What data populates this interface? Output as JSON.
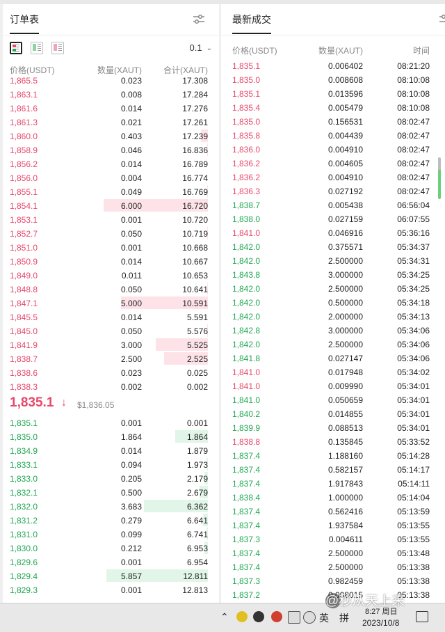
{
  "order_book": {
    "tab_title": "订单表",
    "precision": "0.1",
    "columns": {
      "price": "价格(USDT)",
      "amount": "数量(XAUT)",
      "total": "合计(XAUT)"
    },
    "asks": [
      {
        "price": "1,865.5",
        "amount": "0.023",
        "total": "17.308",
        "depth": 0
      },
      {
        "price": "1,863.1",
        "amount": "0.008",
        "total": "17.284",
        "depth": 0
      },
      {
        "price": "1,861.6",
        "amount": "0.014",
        "total": "17.276",
        "depth": 0
      },
      {
        "price": "1,861.3",
        "amount": "0.021",
        "total": "17.261",
        "depth": 0
      },
      {
        "price": "1,860.0",
        "amount": "0.403",
        "total": "17.239",
        "depth": 0.067
      },
      {
        "price": "1,858.9",
        "amount": "0.046",
        "total": "16.836",
        "depth": 0.008
      },
      {
        "price": "1,856.2",
        "amount": "0.014",
        "total": "16.789",
        "depth": 0
      },
      {
        "price": "1,856.0",
        "amount": "0.004",
        "total": "16.774",
        "depth": 0
      },
      {
        "price": "1,855.1",
        "amount": "0.049",
        "total": "16.769",
        "depth": 0.008
      },
      {
        "price": "1,854.1",
        "amount": "6.000",
        "total": "16.720",
        "depth": 1.0
      },
      {
        "price": "1,853.1",
        "amount": "0.001",
        "total": "10.720",
        "depth": 0
      },
      {
        "price": "1,852.7",
        "amount": "0.050",
        "total": "10.719",
        "depth": 0.008
      },
      {
        "price": "1,851.0",
        "amount": "0.001",
        "total": "10.668",
        "depth": 0
      },
      {
        "price": "1,850.9",
        "amount": "0.014",
        "total": "10.667",
        "depth": 0
      },
      {
        "price": "1,849.0",
        "amount": "0.011",
        "total": "10.653",
        "depth": 0
      },
      {
        "price": "1,848.8",
        "amount": "0.050",
        "total": "10.641",
        "depth": 0.008
      },
      {
        "price": "1,847.1",
        "amount": "5.000",
        "total": "10.591",
        "depth": 0.833
      },
      {
        "price": "1,845.5",
        "amount": "0.014",
        "total": "5.591",
        "depth": 0
      },
      {
        "price": "1,845.0",
        "amount": "0.050",
        "total": "5.576",
        "depth": 0.008
      },
      {
        "price": "1,841.9",
        "amount": "3.000",
        "total": "5.525",
        "depth": 0.5
      },
      {
        "price": "1,838.7",
        "amount": "2.500",
        "total": "2.525",
        "depth": 0.417
      },
      {
        "price": "1,838.6",
        "amount": "0.023",
        "total": "0.025",
        "depth": 0
      },
      {
        "price": "1,838.3",
        "amount": "0.002",
        "total": "0.002",
        "depth": 0
      }
    ],
    "last_price": "1,835.1",
    "last_arrow": "↓",
    "index_price": "$1,836.05",
    "bids": [
      {
        "price": "1,835.1",
        "amount": "0.001",
        "total": "0.001",
        "depth": 0
      },
      {
        "price": "1,835.0",
        "amount": "1.864",
        "total": "1.864",
        "depth": 0.31
      },
      {
        "price": "1,834.9",
        "amount": "0.014",
        "total": "1.879",
        "depth": 0
      },
      {
        "price": "1,833.1",
        "amount": "0.094",
        "total": "1.973",
        "depth": 0.016
      },
      {
        "price": "1,833.0",
        "amount": "0.205",
        "total": "2.179",
        "depth": 0.034
      },
      {
        "price": "1,832.1",
        "amount": "0.500",
        "total": "2.679",
        "depth": 0.083
      },
      {
        "price": "1,832.0",
        "amount": "3.683",
        "total": "6.362",
        "depth": 0.614
      },
      {
        "price": "1,831.2",
        "amount": "0.279",
        "total": "6.641",
        "depth": 0.047
      },
      {
        "price": "1,831.0",
        "amount": "0.099",
        "total": "6.741",
        "depth": 0.016
      },
      {
        "price": "1,830.0",
        "amount": "0.212",
        "total": "6.953",
        "depth": 0.035
      },
      {
        "price": "1,829.6",
        "amount": "0.001",
        "total": "6.954",
        "depth": 0
      },
      {
        "price": "1,829.4",
        "amount": "5.857",
        "total": "12.811",
        "depth": 0.976
      },
      {
        "price": "1,829.3",
        "amount": "0.001",
        "total": "12.813",
        "depth": 0
      }
    ]
  },
  "trades": {
    "tab_title": "最新成交",
    "columns": {
      "price": "价格(USDT)",
      "amount": "数量(XAUT)",
      "time": "时间"
    },
    "rows": [
      {
        "price": "1,835.1",
        "amount": "0.006402",
        "time": "08:21:20",
        "side": "sell"
      },
      {
        "price": "1,835.0",
        "amount": "0.008608",
        "time": "08:10:08",
        "side": "sell"
      },
      {
        "price": "1,835.1",
        "amount": "0.013596",
        "time": "08:10:08",
        "side": "sell"
      },
      {
        "price": "1,835.4",
        "amount": "0.005479",
        "time": "08:10:08",
        "side": "sell"
      },
      {
        "price": "1,835.0",
        "amount": "0.156531",
        "time": "08:02:47",
        "side": "sell"
      },
      {
        "price": "1,835.8",
        "amount": "0.004439",
        "time": "08:02:47",
        "side": "sell"
      },
      {
        "price": "1,836.0",
        "amount": "0.004910",
        "time": "08:02:47",
        "side": "sell"
      },
      {
        "price": "1,836.2",
        "amount": "0.004605",
        "time": "08:02:47",
        "side": "sell"
      },
      {
        "price": "1,836.2",
        "amount": "0.004910",
        "time": "08:02:47",
        "side": "sell"
      },
      {
        "price": "1,836.3",
        "amount": "0.027192",
        "time": "08:02:47",
        "side": "sell"
      },
      {
        "price": "1,838.7",
        "amount": "0.005438",
        "time": "06:56:04",
        "side": "buy"
      },
      {
        "price": "1,838.0",
        "amount": "0.027159",
        "time": "06:07:55",
        "side": "buy"
      },
      {
        "price": "1,841.0",
        "amount": "0.046916",
        "time": "05:36:16",
        "side": "sell"
      },
      {
        "price": "1,842.0",
        "amount": "0.375571",
        "time": "05:34:37",
        "side": "buy"
      },
      {
        "price": "1,842.0",
        "amount": "2.500000",
        "time": "05:34:31",
        "side": "buy"
      },
      {
        "price": "1,843.8",
        "amount": "3.000000",
        "time": "05:34:25",
        "side": "buy"
      },
      {
        "price": "1,842.0",
        "amount": "2.500000",
        "time": "05:34:25",
        "side": "buy"
      },
      {
        "price": "1,842.0",
        "amount": "0.500000",
        "time": "05:34:18",
        "side": "buy"
      },
      {
        "price": "1,842.0",
        "amount": "2.000000",
        "time": "05:34:13",
        "side": "buy"
      },
      {
        "price": "1,842.8",
        "amount": "3.000000",
        "time": "05:34:06",
        "side": "buy"
      },
      {
        "price": "1,842.0",
        "amount": "2.500000",
        "time": "05:34:06",
        "side": "buy"
      },
      {
        "price": "1,841.8",
        "amount": "0.027147",
        "time": "05:34:06",
        "side": "buy"
      },
      {
        "price": "1,841.0",
        "amount": "0.017948",
        "time": "05:34:02",
        "side": "sell"
      },
      {
        "price": "1,841.0",
        "amount": "0.009990",
        "time": "05:34:01",
        "side": "sell"
      },
      {
        "price": "1,841.0",
        "amount": "0.050659",
        "time": "05:34:01",
        "side": "buy"
      },
      {
        "price": "1,840.2",
        "amount": "0.014855",
        "time": "05:34:01",
        "side": "buy"
      },
      {
        "price": "1,839.9",
        "amount": "0.088513",
        "time": "05:34:01",
        "side": "buy"
      },
      {
        "price": "1,838.8",
        "amount": "0.135845",
        "time": "05:33:52",
        "side": "sell"
      },
      {
        "price": "1,837.4",
        "amount": "1.188160",
        "time": "05:14:28",
        "side": "buy"
      },
      {
        "price": "1,837.4",
        "amount": "0.582157",
        "time": "05:14:17",
        "side": "buy"
      },
      {
        "price": "1,837.4",
        "amount": "1.917843",
        "time": "05:14:11",
        "side": "buy"
      },
      {
        "price": "1,838.4",
        "amount": "1.000000",
        "time": "05:14:04",
        "side": "buy"
      },
      {
        "price": "1,837.4",
        "amount": "0.562416",
        "time": "05:13:59",
        "side": "buy"
      },
      {
        "price": "1,837.4",
        "amount": "1.937584",
        "time": "05:13:55",
        "side": "buy"
      },
      {
        "price": "1,837.3",
        "amount": "0.004611",
        "time": "05:13:55",
        "side": "buy"
      },
      {
        "price": "1,837.4",
        "amount": "2.500000",
        "time": "05:13:48",
        "side": "buy"
      },
      {
        "price": "1,837.4",
        "amount": "2.500000",
        "time": "05:13:38",
        "side": "buy"
      },
      {
        "price": "1,837.3",
        "amount": "0.982459",
        "time": "05:13:38",
        "side": "buy"
      },
      {
        "price": "1,837.2",
        "amount": "0.008015",
        "time": "05:13:38",
        "side": "buy"
      }
    ]
  },
  "taskbar": {
    "ime_label": "英",
    "grid_label": "拼",
    "time": "8:27 周日",
    "date": "2023/10/8"
  },
  "watermark": "@秒从天上来",
  "colors": {
    "ask": "#e8486a",
    "bid": "#22a854",
    "ask_depth": "#fde3e8",
    "bid_depth": "#e1f5e8"
  }
}
